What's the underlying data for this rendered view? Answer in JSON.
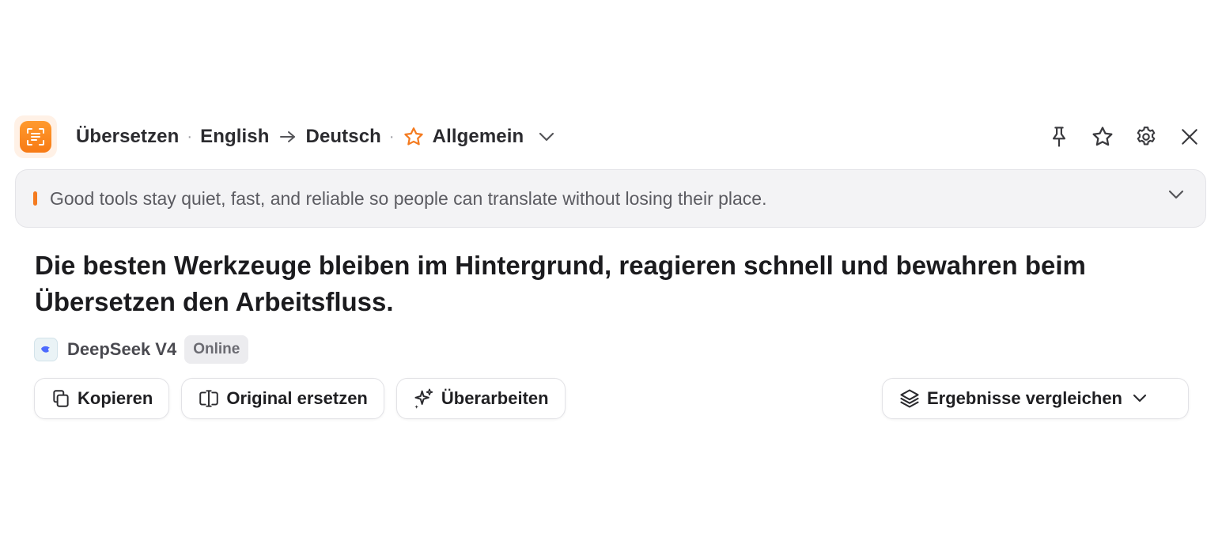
{
  "header": {
    "mode": "Übersetzen",
    "source_lang": "English",
    "target_lang": "Deutsch",
    "style": "Allgemein",
    "icons": [
      "translate-app-icon",
      "arrow-right-icon",
      "star-icon",
      "chevron-down-icon",
      "pin-icon",
      "star-icon",
      "gear-icon",
      "close-icon"
    ]
  },
  "source": {
    "text": "Good tools stay quiet, fast, and reliable so people can translate without losing their place.",
    "accent_color": "#f47b20"
  },
  "result": {
    "text": "Die besten Werkzeuge bleiben im Hintergrund, reagieren schnell und bewahren beim Übersetzen den Arbeitsfluss.",
    "engine": "DeepSeek V4",
    "engine_status": "Online"
  },
  "actions": {
    "copy": "Kopieren",
    "replace": "Original ersetzen",
    "rework": "Überarbeiten",
    "compare": "Ergebnisse vergleichen"
  },
  "colors": {
    "brand": "#f7841c",
    "text": "#1f1f22",
    "muted": "#5b5b61"
  }
}
